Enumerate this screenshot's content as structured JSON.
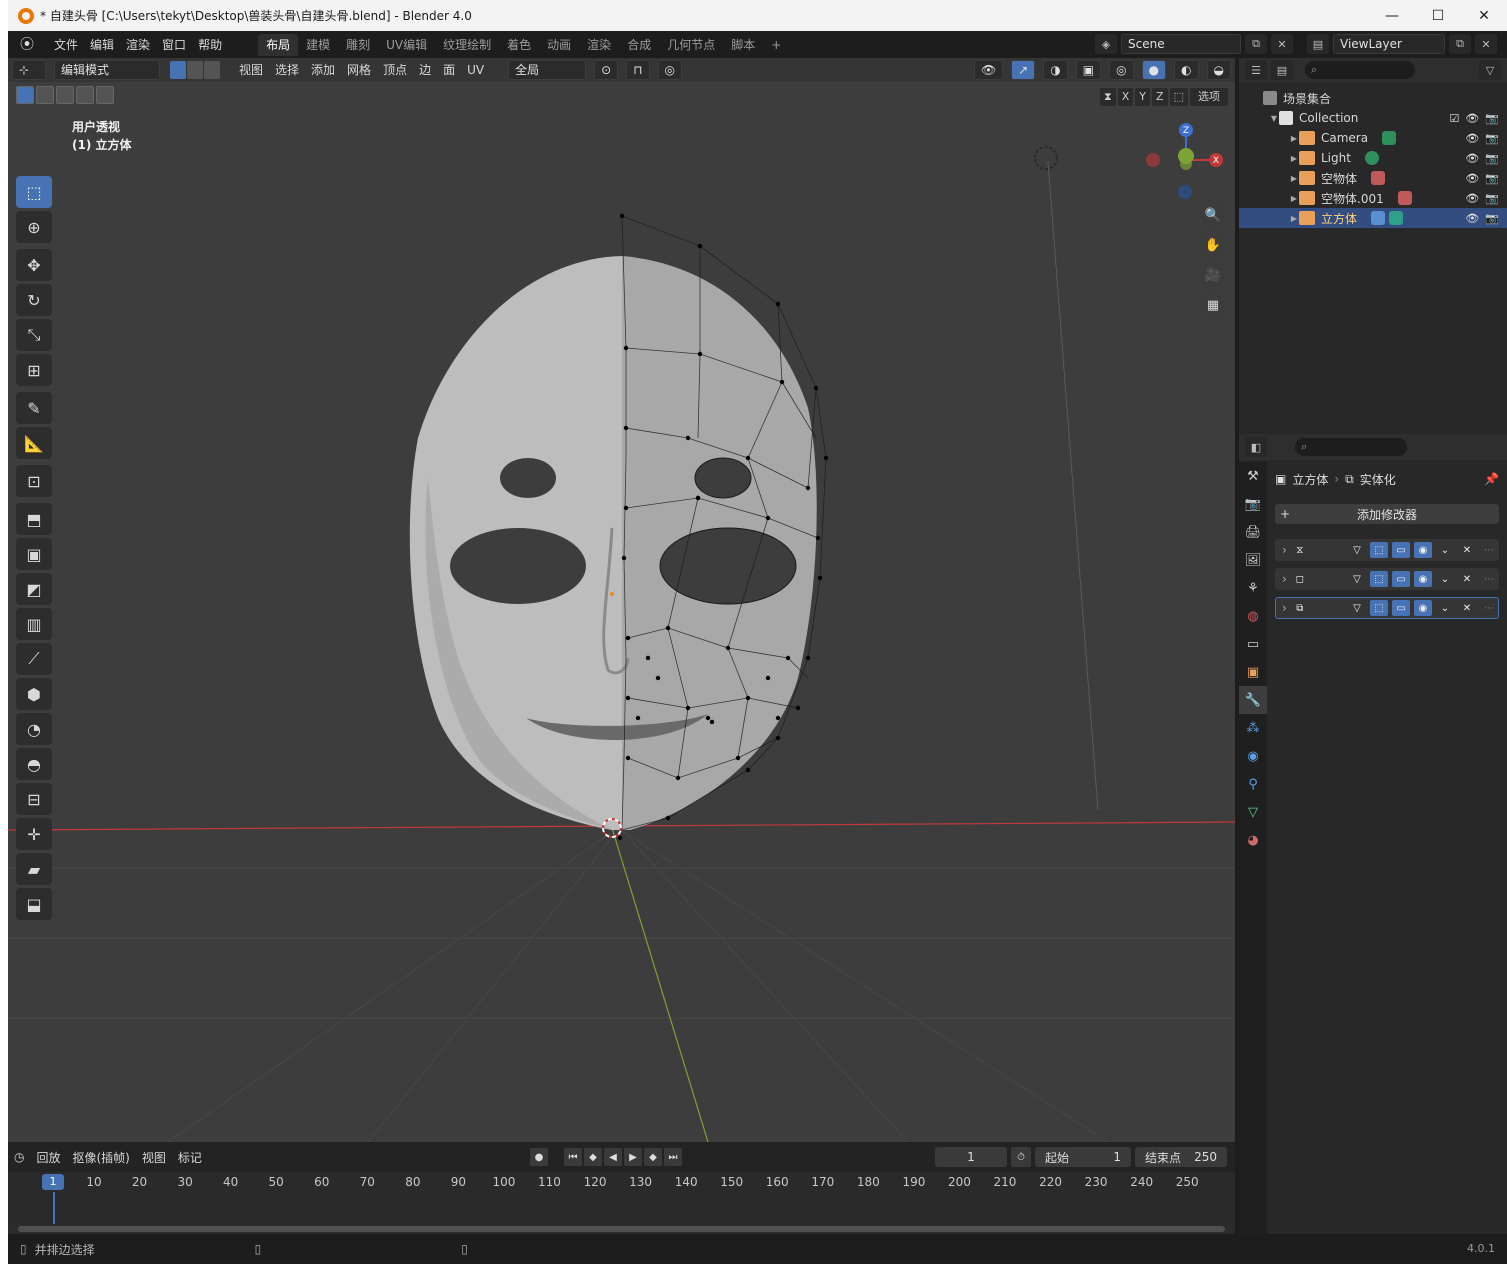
{
  "window": {
    "title": "* 自建头骨 [C:\\Users\\tekyt\\Desktop\\兽装头骨\\自建头骨.blend] - Blender 4.0",
    "controls": [
      "—",
      "☐",
      "✕"
    ]
  },
  "menu": {
    "items": [
      "文件",
      "编辑",
      "渲染",
      "窗口",
      "帮助"
    ]
  },
  "workspaces": {
    "tabs": [
      "布局",
      "建模",
      "雕刻",
      "UV编辑",
      "纹理绘制",
      "着色",
      "动画",
      "渲染",
      "合成",
      "几何节点",
      "脚本"
    ],
    "active": "布局",
    "add": "+"
  },
  "scene": {
    "name": "Scene",
    "view_layer": "ViewLayer"
  },
  "viewport_header": {
    "mode": "编辑模式",
    "menus": [
      "视图",
      "选择",
      "添加",
      "网格",
      "顶点",
      "边",
      "面",
      "UV"
    ],
    "transform_orientation": "全局",
    "options": "选项",
    "axes": [
      "X",
      "Y",
      "Z"
    ]
  },
  "viewport": {
    "view_label": "用户透视",
    "object_label": "(1) 立方体",
    "gizmo": {
      "x": "X",
      "y": "Y",
      "z": "Z"
    },
    "colors": {
      "background": "#3d3d3d",
      "x_axis": "#c0393b",
      "y_axis": "#7ea337",
      "z_axis": "#3a6fcf"
    }
  },
  "toolbar": {
    "tools": [
      "select-box",
      "cursor",
      "move",
      "rotate",
      "scale",
      "transform",
      "annotate",
      "measure",
      "add-cube",
      "extrude",
      "inset",
      "bevel",
      "loop-cut",
      "knife",
      "poly-build",
      "spin",
      "smooth",
      "edge-slide",
      "shrink-fatten",
      "shear",
      "rip"
    ]
  },
  "outliner": {
    "root": "场景集合",
    "collection": "Collection",
    "items": [
      {
        "name": "Camera",
        "icon": "camera-icon",
        "color": "#e8a05a"
      },
      {
        "name": "Light",
        "icon": "light-icon",
        "color": "#e8a05a"
      },
      {
        "name": "空物体",
        "icon": "image-empty-icon",
        "color": "#e8a05a"
      },
      {
        "name": "空物体.001",
        "icon": "image-empty-icon",
        "color": "#e8a05a"
      },
      {
        "name": "立方体",
        "icon": "mesh-icon",
        "color": "#e8a05a",
        "selected": true
      }
    ]
  },
  "properties": {
    "breadcrumb_object": "立方体",
    "breadcrumb_modifier": "实体化",
    "add_modifier": "添加修改器",
    "modifiers": [
      {
        "icon": "mirror-modifier-icon"
      },
      {
        "icon": "subdivision-modifier-icon"
      },
      {
        "icon": "solidify-modifier-icon",
        "selected": true
      }
    ]
  },
  "timeline": {
    "menus": [
      "回放",
      "抠像(插帧)",
      "视图",
      "标记"
    ],
    "current_frame": "1",
    "start_label": "起始",
    "start": "1",
    "end_label": "结束点",
    "end": "250",
    "ticks": [
      "10",
      "20",
      "30",
      "40",
      "50",
      "60",
      "70",
      "80",
      "90",
      "100",
      "110",
      "120",
      "130",
      "140",
      "150",
      "160",
      "170",
      "180",
      "190",
      "200",
      "210",
      "220",
      "230",
      "240",
      "250"
    ],
    "cursor_frame": "1"
  },
  "statusbar": {
    "hint": "并排边选择",
    "version": "4.0.1"
  }
}
